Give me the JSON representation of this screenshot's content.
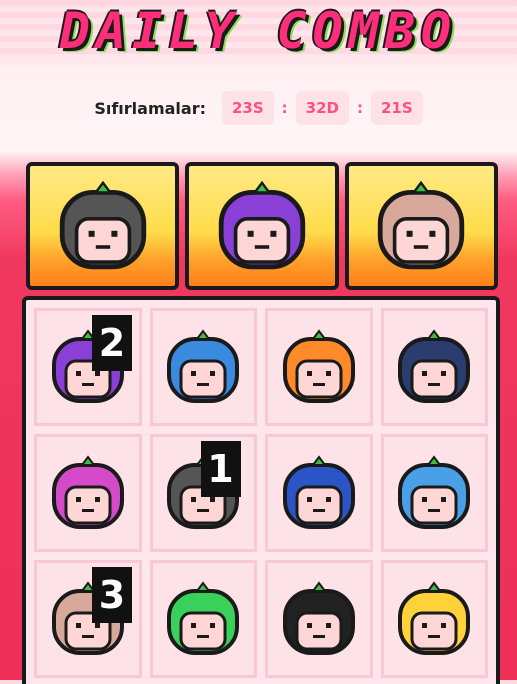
{
  "title": "DAILY COMBO",
  "reset": {
    "label": "Sıfırlamalar:",
    "hours": "23S",
    "minutes": "32D",
    "seconds": "21S",
    "separator": ":"
  },
  "combo": [
    {
      "icon": "crying-gray-char-icon",
      "hair": "#555555"
    },
    {
      "icon": "angry-purple-char-icon",
      "hair": "#8a3fd6"
    },
    {
      "icon": "blushing-cat-char-icon",
      "hair": "#d8a89a"
    }
  ],
  "grid": [
    {
      "icon": "sad-purple-char-icon",
      "hair": "#8a3fd6",
      "badge": "2"
    },
    {
      "icon": "robot-cat-char-icon",
      "hair": "#3a8be0",
      "badge": ""
    },
    {
      "icon": "orange-char-icon",
      "hair": "#ff8a2a",
      "badge": ""
    },
    {
      "icon": "bomb-char-icon",
      "hair": "#2b3c6e",
      "badge": ""
    },
    {
      "icon": "pink-sad-char-icon",
      "hair": "#d44ac8",
      "badge": ""
    },
    {
      "icon": "crying-gray-char-icon",
      "hair": "#555555",
      "badge": "1"
    },
    {
      "icon": "robot-helmet-char-icon",
      "hair": "#2b55c6",
      "badge": ""
    },
    {
      "icon": "sleepy-blue-char-icon",
      "hair": "#4aa0e6",
      "badge": ""
    },
    {
      "icon": "cat-char-icon",
      "hair": "#d8a89a",
      "badge": "3"
    },
    {
      "icon": "green-char-icon",
      "hair": "#3ad15a",
      "badge": ""
    },
    {
      "icon": "panda-char-icon",
      "hair": "#222222",
      "badge": ""
    },
    {
      "icon": "heart-eyes-blonde-char-icon",
      "hair": "#ffd23a",
      "badge": ""
    }
  ]
}
